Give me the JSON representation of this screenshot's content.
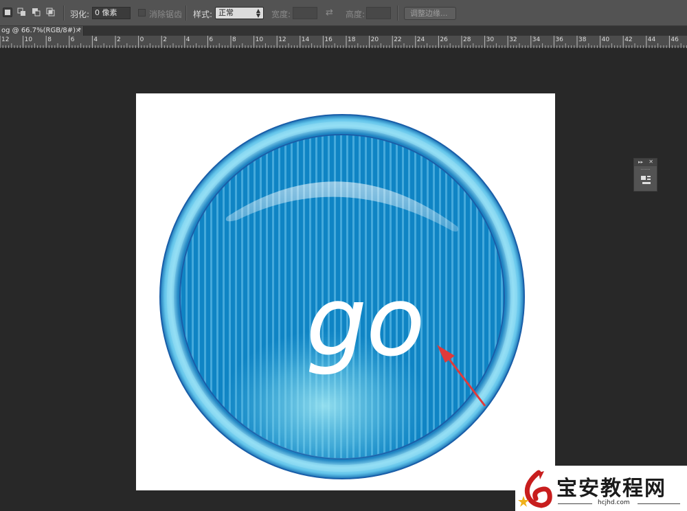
{
  "options_bar": {
    "selection_modes": [
      "new-selection",
      "add-to-selection",
      "subtract-from-selection",
      "intersect-with-selection"
    ],
    "feather_label": "羽化:",
    "feather_value": "0 像素",
    "antialias_label": "消除锯齿",
    "style_label": "样式:",
    "style_value": "正常",
    "width_label": "宽度:",
    "width_value": "",
    "height_label": "高度:",
    "height_value": "",
    "refine_edge_label": "调整边缘..."
  },
  "document_tab": {
    "title": "og @ 66.7%(RGB/8#) *",
    "close_glyph": "×"
  },
  "ruler": {
    "labels": [
      "12",
      "10",
      "8",
      "6",
      "4",
      "2",
      "0",
      "2",
      "4",
      "6",
      "8",
      "10",
      "12",
      "14",
      "16",
      "18",
      "20",
      "22",
      "24",
      "26",
      "28",
      "30",
      "32",
      "34",
      "36",
      "38",
      "40",
      "42",
      "44",
      "46"
    ]
  },
  "artwork": {
    "text": "go",
    "text_color": "#ffffff",
    "button_color": "#1a8ccc",
    "ring_color": "#7fd3ef",
    "stripe_color": "#5cb8e4",
    "arrow_color": "#e03a3a"
  },
  "mini_panel": {
    "expand_glyph": "▸▸",
    "close_glyph": "✕"
  },
  "watermark": {
    "name": "宝安教程网",
    "url": "hcjhd.com"
  }
}
